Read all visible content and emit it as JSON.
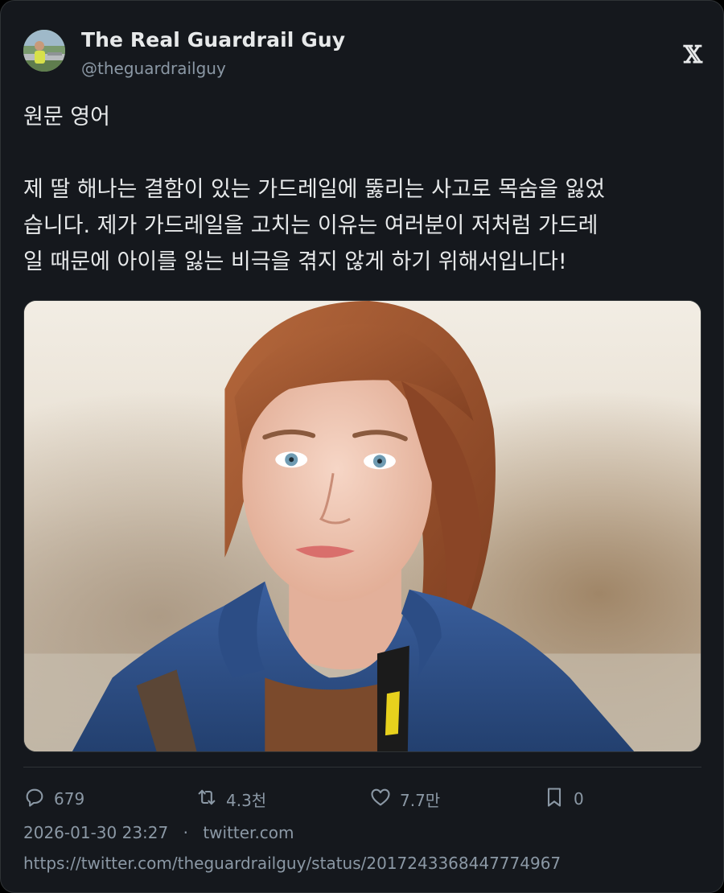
{
  "author": {
    "display_name": "The Real Guardrail Guy",
    "handle": "@theguardrailguy",
    "avatar_icon": "avatar-photo"
  },
  "platform": {
    "logo_icon": "x-logo-icon",
    "logo_glyph": "𝕏"
  },
  "tweet": {
    "lines": [
      "원문 영어",
      "",
      "제 딸 해나는 결함이 있는 가드레일에 뚫리는 사고로 목숨을 잃었",
      "습니다. 제가 가드레일을 고치는 이유는 여러분이 저처럼 가드레",
      "일 때문에 아이를 잃는 비극을 겪지 않게 하기 위해서입니다!"
    ],
    "media_alt": "photo"
  },
  "actions": {
    "replies": {
      "icon": "reply-icon",
      "count": "679"
    },
    "retweets": {
      "icon": "retweet-icon",
      "count": "4.3천"
    },
    "likes": {
      "icon": "heart-icon",
      "count": "7.7만"
    },
    "bookmarks": {
      "icon": "bookmark-icon",
      "count": "0"
    }
  },
  "meta": {
    "timestamp": "2026-01-30 23:27",
    "separator": "·",
    "source": "twitter.com",
    "url": "https://twitter.com/theguardrailguy/status/2017243368447774967"
  },
  "colors": {
    "background": "#15181d",
    "text_primary": "#e7e9ea",
    "text_secondary": "#8b98a5",
    "border": "#2f3336"
  }
}
